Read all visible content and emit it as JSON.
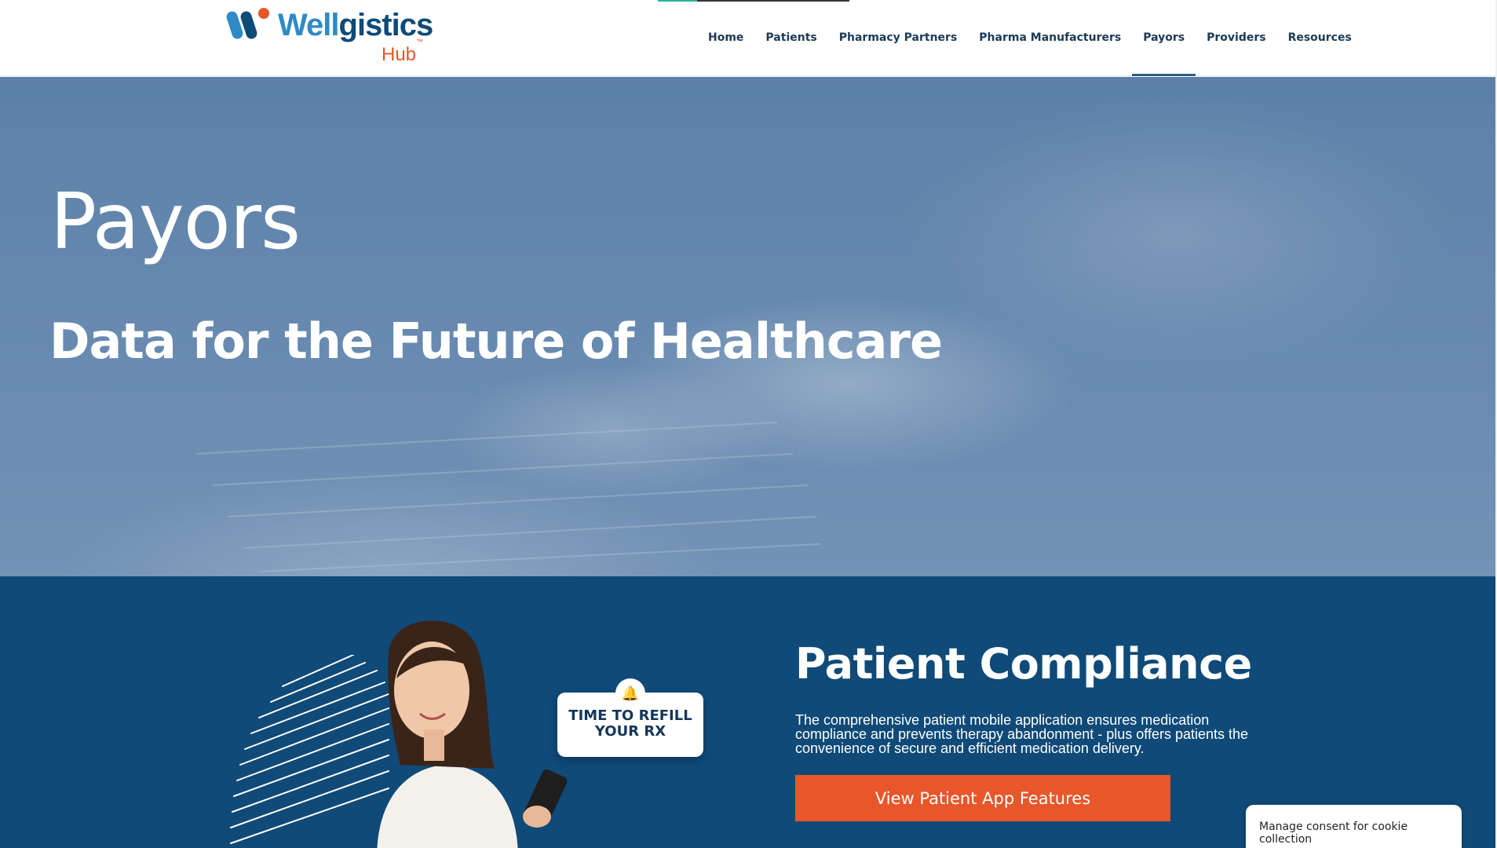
{
  "header": {
    "logo": {
      "word_light": "Well",
      "word_dark": "gistics",
      "hub": "Hub",
      "tm": "™",
      "colors": {
        "blue": "#2f8ac6",
        "navy": "#0f4a78",
        "orange": "#e8562a"
      }
    },
    "nav": [
      {
        "label": "Home",
        "active": false
      },
      {
        "label": "Patients",
        "active": false
      },
      {
        "label": "Pharmacy Partners",
        "active": false
      },
      {
        "label": "Pharma Manufacturers",
        "active": false
      },
      {
        "label": "Payors",
        "active": true
      },
      {
        "label": "Providers",
        "active": false
      },
      {
        "label": "Resources",
        "active": false
      }
    ]
  },
  "hero": {
    "title": "Payors",
    "subtitle": "Data for the Future of Healthcare"
  },
  "compliance": {
    "title": "Patient Compliance",
    "body": "The comprehensive patient mobile application ensures medication compliance and prevents therapy abandonment - plus offers patients the convenience of secure and efficient medication delivery.",
    "button_label": "View Patient App Features",
    "refill_card": {
      "line1": "TIME TO REFILL",
      "line2": "YOUR RX",
      "icon": "bell-icon"
    },
    "colors": {
      "background": "#0f4a78",
      "button": "#e8562a"
    }
  },
  "cookie": {
    "label": "Manage consent for cookie collection"
  }
}
